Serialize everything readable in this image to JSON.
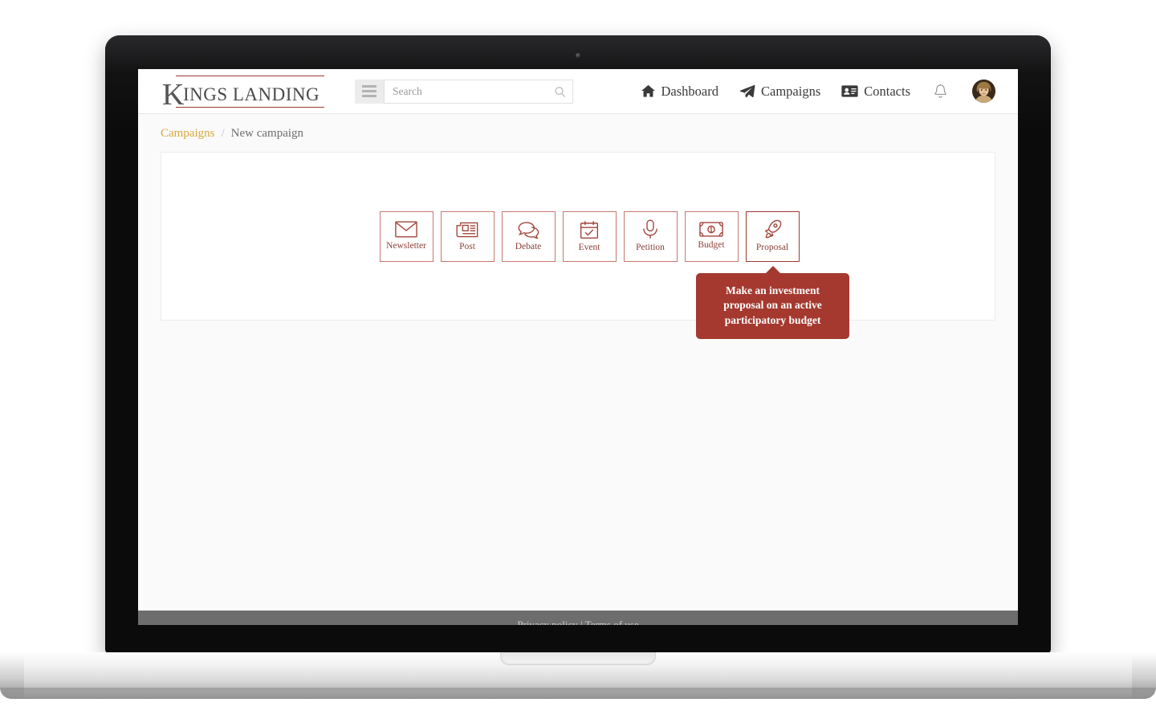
{
  "brand": {
    "logo_initial": "K",
    "logo_text": "INGS LANDING",
    "accent_red": "#9c3a31",
    "accent_gold": "#d8a93c"
  },
  "header": {
    "menu_icon": "hamburger-icon",
    "search": {
      "placeholder": "Search",
      "value": "",
      "icon": "search-icon"
    },
    "nav": [
      {
        "label": "Dashboard",
        "icon": "home-icon"
      },
      {
        "label": "Campaigns",
        "icon": "paper-plane-icon"
      },
      {
        "label": "Contacts",
        "icon": "id-card-icon"
      }
    ],
    "notifications_icon": "bell-icon",
    "avatar_icon": "user-avatar"
  },
  "breadcrumb": {
    "parent": "Campaigns",
    "separator": "/",
    "current": "New campaign"
  },
  "campaign_types": [
    {
      "label": "Newsletter",
      "icon": "envelope-icon",
      "active": false
    },
    {
      "label": "Post",
      "icon": "newspaper-icon",
      "active": false
    },
    {
      "label": "Debate",
      "icon": "comments-icon",
      "active": false
    },
    {
      "label": "Event",
      "icon": "calendar-check-icon",
      "active": false
    },
    {
      "label": "Petition",
      "icon": "microphone-icon",
      "active": false
    },
    {
      "label": "Budget",
      "icon": "money-bill-icon",
      "active": false
    },
    {
      "label": "Proposal",
      "icon": "rocket-icon",
      "active": true
    }
  ],
  "tooltip": {
    "text": "Make an investment proposal on an active participatory budget",
    "target": "Proposal",
    "background": "#a5392f"
  },
  "footer": {
    "text": "Privacy policy | Terms of use"
  }
}
